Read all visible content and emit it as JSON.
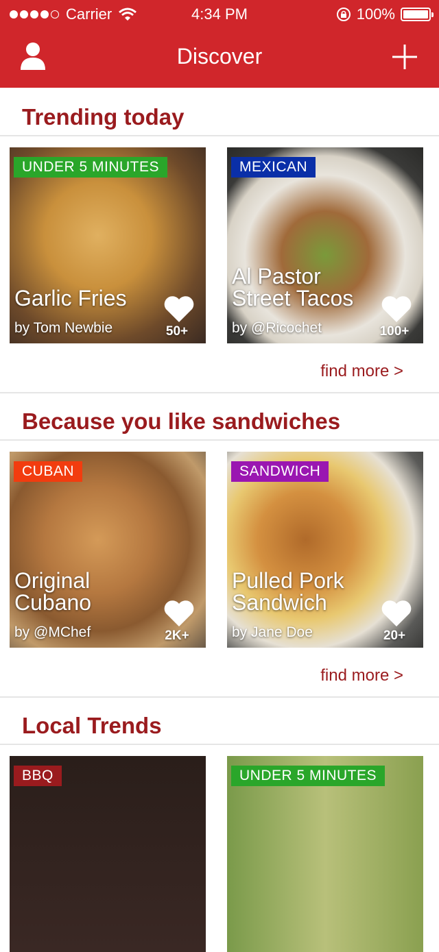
{
  "status_bar": {
    "carrier": "Carrier",
    "time": "4:34 PM",
    "battery": "100%"
  },
  "nav": {
    "title": "Discover"
  },
  "sections": [
    {
      "title": "Trending today",
      "find_more": "find more >",
      "cards": [
        {
          "tag": "UNDER 5 MINUTES",
          "tag_color": "#2aa62a",
          "title": "Garlic Fries",
          "author": "by Tom Newbie",
          "likes": "50+"
        },
        {
          "tag": "MEXICAN",
          "tag_color": "#0a2fa8",
          "title": "Al Pastor Street Tacos",
          "author": "by @Ricochet",
          "likes": "100+"
        }
      ]
    },
    {
      "title": "Because you like sandwiches",
      "find_more": "find more >",
      "cards": [
        {
          "tag": "CUBAN",
          "tag_color": "#f23c0f",
          "title": "Original Cubano",
          "author": "by @MChef",
          "likes": "2K+"
        },
        {
          "tag": "SANDWICH",
          "tag_color": "#9a16b1",
          "title": "Pulled Pork Sandwich",
          "author": "by Jane Doe",
          "likes": "20+"
        }
      ]
    },
    {
      "title": "Local Trends",
      "cards": [
        {
          "tag": "BBQ",
          "tag_color": "#9a1b1e"
        },
        {
          "tag": "UNDER 5 MINUTES",
          "tag_color": "#2aa62a"
        }
      ]
    }
  ],
  "colors": {
    "header": "#d0262b",
    "accent_text": "#9a1b1e"
  }
}
